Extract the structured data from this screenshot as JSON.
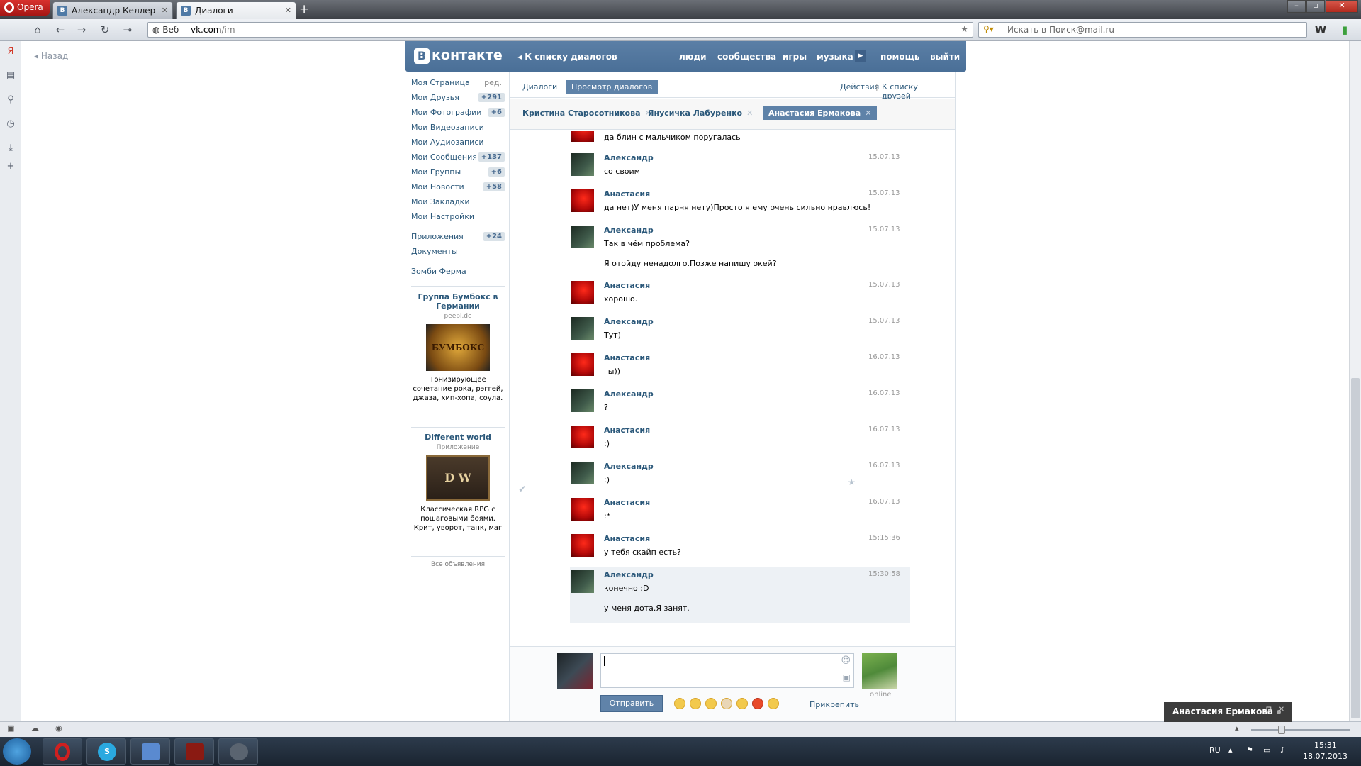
{
  "browser": {
    "menu_label": "Opera",
    "tabs": [
      {
        "label": "Александр Келлер",
        "icon": "vk-icon"
      },
      {
        "label": "Диалоги",
        "icon": "vk-icon"
      }
    ],
    "address": {
      "scheme": "Веб",
      "host": "vk.com",
      "path": "/im"
    },
    "search_placeholder": "Искать в Поиск@mail.ru"
  },
  "page": {
    "back_label": "Назад",
    "header": {
      "logo": "контакте",
      "back_to_list": "К списку диалогов",
      "links": [
        "люди",
        "сообщества",
        "игры",
        "музыка",
        "помощь",
        "выйти"
      ]
    },
    "left_menu": [
      {
        "label": "Моя Страница",
        "extra": "ред."
      },
      {
        "label": "Мои Друзья",
        "count": "+291"
      },
      {
        "label": "Мои Фотографии",
        "count": "+6"
      },
      {
        "label": "Мои Видеозаписи"
      },
      {
        "label": "Мои Аудиозаписи"
      },
      {
        "label": "Мои Сообщения",
        "count": "+137"
      },
      {
        "label": "Мои Группы",
        "count": "+6"
      },
      {
        "label": "Мои Новости",
        "count": "+58"
      },
      {
        "label": "Мои Закладки"
      },
      {
        "label": "Мои Настройки"
      },
      {
        "label": "Приложения",
        "count": "+24"
      },
      {
        "label": "Документы"
      },
      {
        "label": "Зомби Ферма"
      }
    ],
    "ads": [
      {
        "title": "Группа Бумбокс в Германии",
        "sub": "peepl.de",
        "desc": "Тонизирующее сочетание рока, рэггей, джаза, хип-хопа, соула.",
        "image_text": "БУМБОКС"
      },
      {
        "title": "Different world",
        "sub": "Приложение",
        "desc": "Классическая RPG с пошаговыми боями. Крит, уворот, танк, маг",
        "image_text": "D W"
      }
    ],
    "all_ads": "Все объявления",
    "view_tabs": [
      "Диалоги",
      "Просмотр диалогов"
    ],
    "actions": "Действия",
    "to_friends": "К списку друзей",
    "peers": [
      "Кристина Старосотникова",
      "Янусичка Лабуренко",
      "Анастасия Ермакова"
    ],
    "top_snippet": "да блин с мальчиком поругалась",
    "messages": [
      {
        "name": "Александр",
        "text": "со своим",
        "date": "15.07.13",
        "who": "a"
      },
      {
        "name": "Анастасия",
        "text": "да нет)У меня парня нету)Просто я ему очень сильно нравлюсь!",
        "date": "15.07.13",
        "who": "n"
      },
      {
        "name": "Александр",
        "text": "Так в чём проблема?",
        "text2": "Я отойду ненадолго.Позже напишу окей?",
        "date": "15.07.13",
        "who": "a"
      },
      {
        "name": "Анастасия",
        "text": "хорошо.",
        "date": "15.07.13",
        "who": "n"
      },
      {
        "name": "Александр",
        "text": "Тут)",
        "date": "15.07.13",
        "who": "a"
      },
      {
        "name": "Анастасия",
        "text": "гы))",
        "date": "16.07.13",
        "who": "n"
      },
      {
        "name": "Александр",
        "text": "?",
        "date": "16.07.13",
        "who": "a"
      },
      {
        "name": "Анастасия",
        "text": ":)",
        "date": "16.07.13",
        "who": "n"
      },
      {
        "name": "Александр",
        "text": ":)",
        "date": "16.07.13",
        "who": "a"
      },
      {
        "name": "Анастасия",
        "text": ":*",
        "date": "16.07.13",
        "who": "n"
      },
      {
        "name": "Анастасия",
        "text": "у тебя скайп есть?",
        "date": "15:15:36",
        "who": "n"
      },
      {
        "name": "Александр",
        "text": "конечно :D",
        "text2": "у меня дота.Я занят.",
        "date": "15:30:58",
        "who": "a"
      }
    ],
    "send_label": "Отправить",
    "attach_label": "Прикрепить",
    "online_label": "online",
    "chat_popup": "Анастасия Ермакова"
  },
  "taskbar": {
    "lang": "RU",
    "time": "15:31",
    "date": "18.07.2013"
  },
  "colors": {
    "vk_blue": "#4a6f97",
    "link": "#2b587a",
    "opera_red": "#c3201d"
  }
}
